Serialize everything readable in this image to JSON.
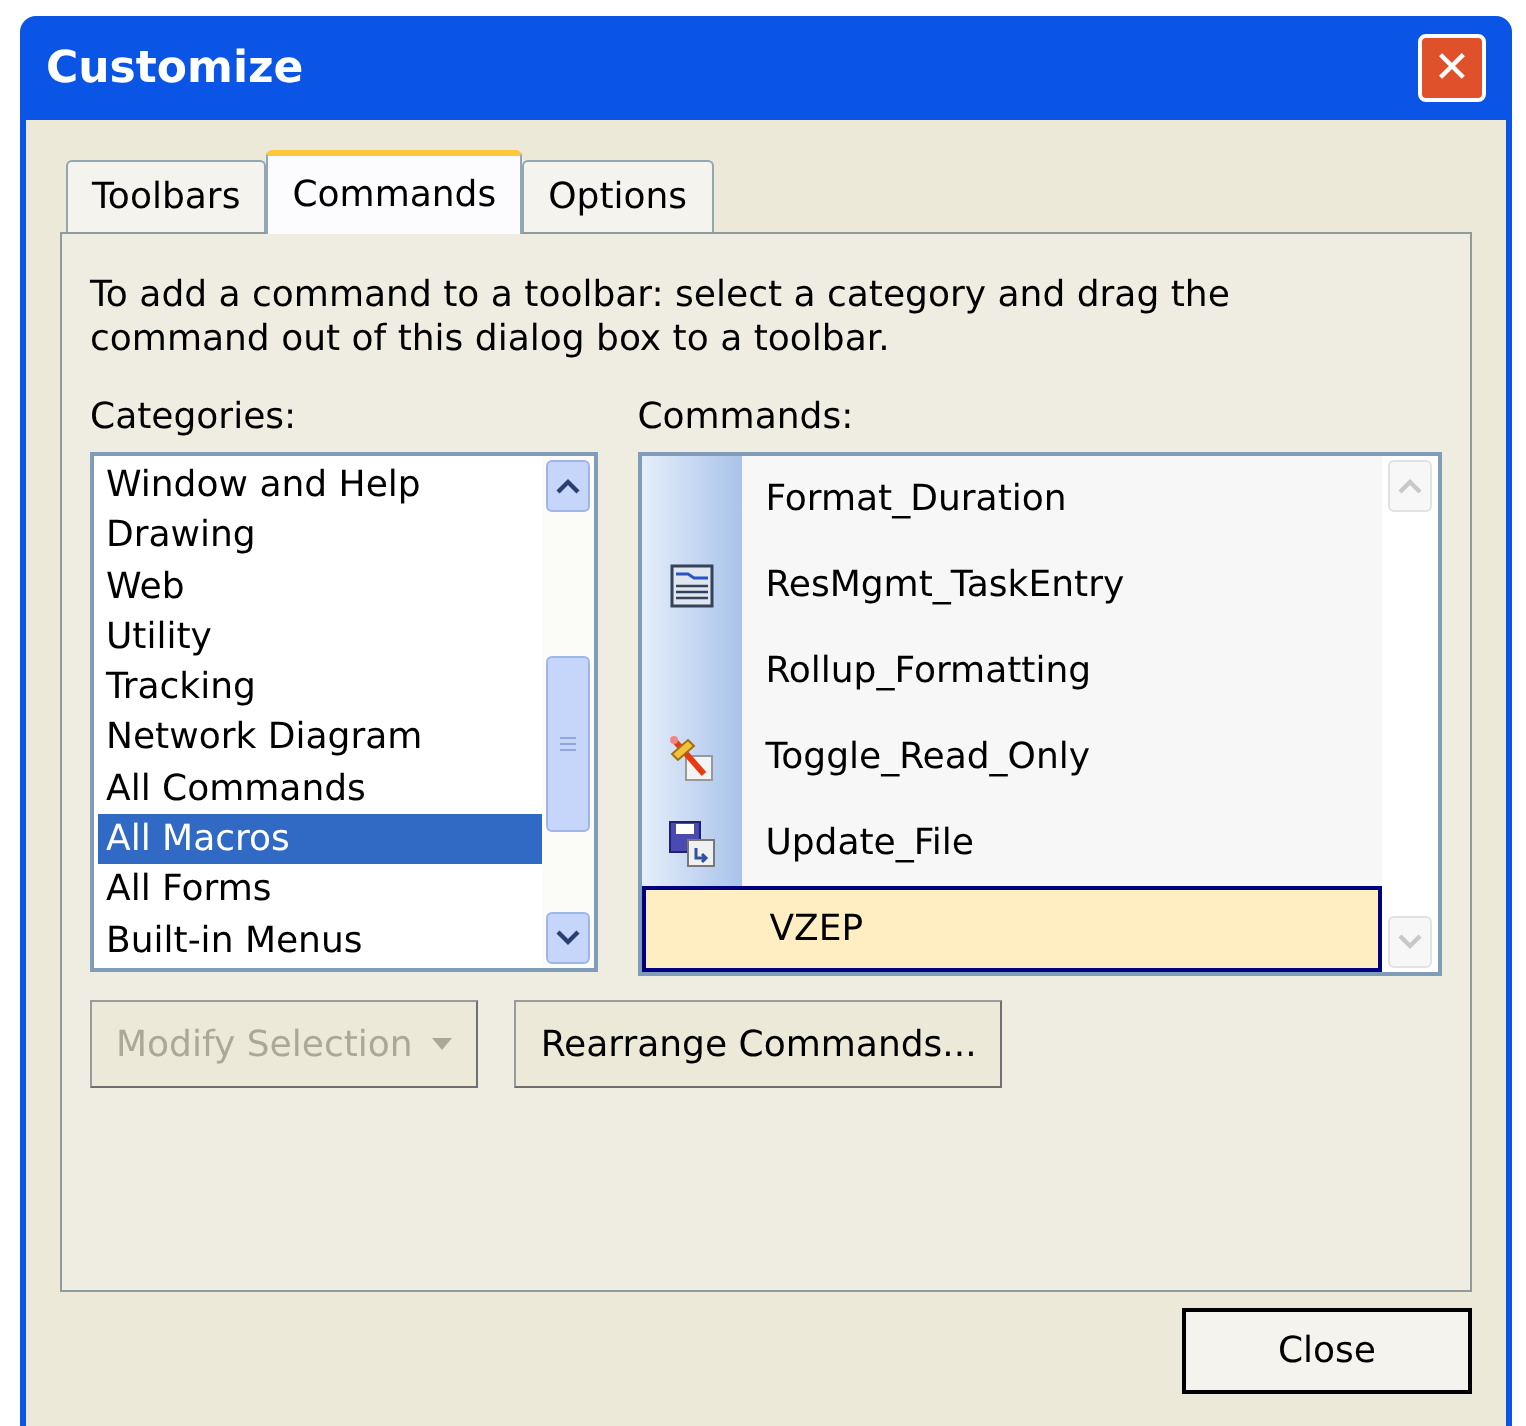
{
  "window": {
    "title": "Customize",
    "close_label": "✕"
  },
  "tabs": [
    {
      "label": "Toolbars",
      "selected": false
    },
    {
      "label": "Commands",
      "selected": true
    },
    {
      "label": "Options",
      "selected": false
    }
  ],
  "instructions": "To add a command to a toolbar: select a category and drag the command out of this dialog box to a toolbar.",
  "categories": {
    "label": "Categories:",
    "items": [
      {
        "label": "Window and Help",
        "selected": false
      },
      {
        "label": "Drawing",
        "selected": false
      },
      {
        "label": "Web",
        "selected": false
      },
      {
        "label": "Utility",
        "selected": false
      },
      {
        "label": "Tracking",
        "selected": false
      },
      {
        "label": "Network Diagram",
        "selected": false
      },
      {
        "label": "All Commands",
        "selected": false
      },
      {
        "label": "All Macros",
        "selected": true
      },
      {
        "label": "All Forms",
        "selected": false
      },
      {
        "label": "Built-in Menus",
        "selected": false
      }
    ]
  },
  "commands": {
    "label": "Commands:",
    "items": [
      {
        "label": "Format_Duration",
        "kind": "none",
        "selected": false
      },
      {
        "label": "ResMgmt_TaskEntry",
        "kind": "form",
        "selected": false
      },
      {
        "label": "Rollup_Formatting",
        "kind": "none",
        "selected": false
      },
      {
        "label": "Toggle_Read_Only",
        "kind": "pencil",
        "selected": false
      },
      {
        "label": "Update_File",
        "kind": "disk",
        "selected": false
      },
      {
        "label": "VZEP",
        "kind": "none",
        "selected": true
      }
    ]
  },
  "buttons": [
    {
      "label": "Modify Selection",
      "disabled": true,
      "dropdown": true
    },
    {
      "label": "Rearrange Commands...",
      "disabled": false,
      "dropdown": false
    }
  ],
  "footer_button": {
    "label": "Close"
  }
}
